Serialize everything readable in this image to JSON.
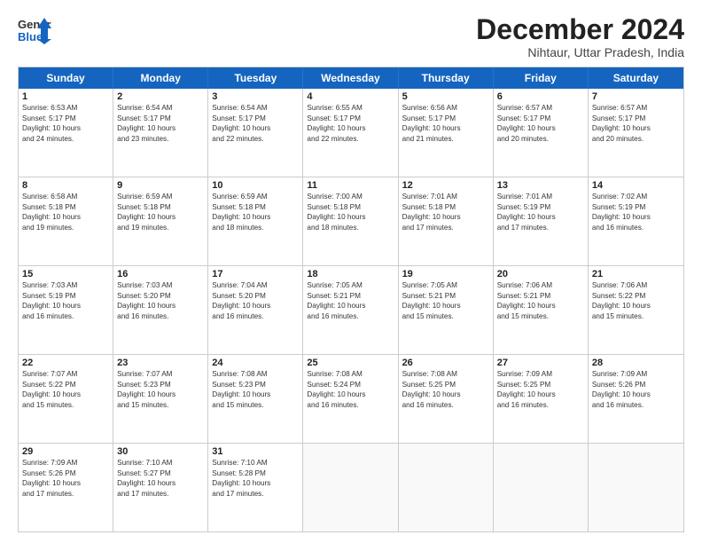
{
  "header": {
    "logo_general": "General",
    "logo_blue": "Blue",
    "month_title": "December 2024",
    "location": "Nihtaur, Uttar Pradesh, India"
  },
  "weekdays": [
    "Sunday",
    "Monday",
    "Tuesday",
    "Wednesday",
    "Thursday",
    "Friday",
    "Saturday"
  ],
  "rows": [
    [
      {
        "day": "1",
        "info": "Sunrise: 6:53 AM\nSunset: 5:17 PM\nDaylight: 10 hours\nand 24 minutes."
      },
      {
        "day": "2",
        "info": "Sunrise: 6:54 AM\nSunset: 5:17 PM\nDaylight: 10 hours\nand 23 minutes."
      },
      {
        "day": "3",
        "info": "Sunrise: 6:54 AM\nSunset: 5:17 PM\nDaylight: 10 hours\nand 22 minutes."
      },
      {
        "day": "4",
        "info": "Sunrise: 6:55 AM\nSunset: 5:17 PM\nDaylight: 10 hours\nand 22 minutes."
      },
      {
        "day": "5",
        "info": "Sunrise: 6:56 AM\nSunset: 5:17 PM\nDaylight: 10 hours\nand 21 minutes."
      },
      {
        "day": "6",
        "info": "Sunrise: 6:57 AM\nSunset: 5:17 PM\nDaylight: 10 hours\nand 20 minutes."
      },
      {
        "day": "7",
        "info": "Sunrise: 6:57 AM\nSunset: 5:17 PM\nDaylight: 10 hours\nand 20 minutes."
      }
    ],
    [
      {
        "day": "8",
        "info": "Sunrise: 6:58 AM\nSunset: 5:18 PM\nDaylight: 10 hours\nand 19 minutes."
      },
      {
        "day": "9",
        "info": "Sunrise: 6:59 AM\nSunset: 5:18 PM\nDaylight: 10 hours\nand 19 minutes."
      },
      {
        "day": "10",
        "info": "Sunrise: 6:59 AM\nSunset: 5:18 PM\nDaylight: 10 hours\nand 18 minutes."
      },
      {
        "day": "11",
        "info": "Sunrise: 7:00 AM\nSunset: 5:18 PM\nDaylight: 10 hours\nand 18 minutes."
      },
      {
        "day": "12",
        "info": "Sunrise: 7:01 AM\nSunset: 5:18 PM\nDaylight: 10 hours\nand 17 minutes."
      },
      {
        "day": "13",
        "info": "Sunrise: 7:01 AM\nSunset: 5:19 PM\nDaylight: 10 hours\nand 17 minutes."
      },
      {
        "day": "14",
        "info": "Sunrise: 7:02 AM\nSunset: 5:19 PM\nDaylight: 10 hours\nand 16 minutes."
      }
    ],
    [
      {
        "day": "15",
        "info": "Sunrise: 7:03 AM\nSunset: 5:19 PM\nDaylight: 10 hours\nand 16 minutes."
      },
      {
        "day": "16",
        "info": "Sunrise: 7:03 AM\nSunset: 5:20 PM\nDaylight: 10 hours\nand 16 minutes."
      },
      {
        "day": "17",
        "info": "Sunrise: 7:04 AM\nSunset: 5:20 PM\nDaylight: 10 hours\nand 16 minutes."
      },
      {
        "day": "18",
        "info": "Sunrise: 7:05 AM\nSunset: 5:21 PM\nDaylight: 10 hours\nand 16 minutes."
      },
      {
        "day": "19",
        "info": "Sunrise: 7:05 AM\nSunset: 5:21 PM\nDaylight: 10 hours\nand 15 minutes."
      },
      {
        "day": "20",
        "info": "Sunrise: 7:06 AM\nSunset: 5:21 PM\nDaylight: 10 hours\nand 15 minutes."
      },
      {
        "day": "21",
        "info": "Sunrise: 7:06 AM\nSunset: 5:22 PM\nDaylight: 10 hours\nand 15 minutes."
      }
    ],
    [
      {
        "day": "22",
        "info": "Sunrise: 7:07 AM\nSunset: 5:22 PM\nDaylight: 10 hours\nand 15 minutes."
      },
      {
        "day": "23",
        "info": "Sunrise: 7:07 AM\nSunset: 5:23 PM\nDaylight: 10 hours\nand 15 minutes."
      },
      {
        "day": "24",
        "info": "Sunrise: 7:08 AM\nSunset: 5:23 PM\nDaylight: 10 hours\nand 15 minutes."
      },
      {
        "day": "25",
        "info": "Sunrise: 7:08 AM\nSunset: 5:24 PM\nDaylight: 10 hours\nand 16 minutes."
      },
      {
        "day": "26",
        "info": "Sunrise: 7:08 AM\nSunset: 5:25 PM\nDaylight: 10 hours\nand 16 minutes."
      },
      {
        "day": "27",
        "info": "Sunrise: 7:09 AM\nSunset: 5:25 PM\nDaylight: 10 hours\nand 16 minutes."
      },
      {
        "day": "28",
        "info": "Sunrise: 7:09 AM\nSunset: 5:26 PM\nDaylight: 10 hours\nand 16 minutes."
      }
    ],
    [
      {
        "day": "29",
        "info": "Sunrise: 7:09 AM\nSunset: 5:26 PM\nDaylight: 10 hours\nand 17 minutes."
      },
      {
        "day": "30",
        "info": "Sunrise: 7:10 AM\nSunset: 5:27 PM\nDaylight: 10 hours\nand 17 minutes."
      },
      {
        "day": "31",
        "info": "Sunrise: 7:10 AM\nSunset: 5:28 PM\nDaylight: 10 hours\nand 17 minutes."
      },
      {
        "day": "",
        "info": ""
      },
      {
        "day": "",
        "info": ""
      },
      {
        "day": "",
        "info": ""
      },
      {
        "day": "",
        "info": ""
      }
    ]
  ]
}
